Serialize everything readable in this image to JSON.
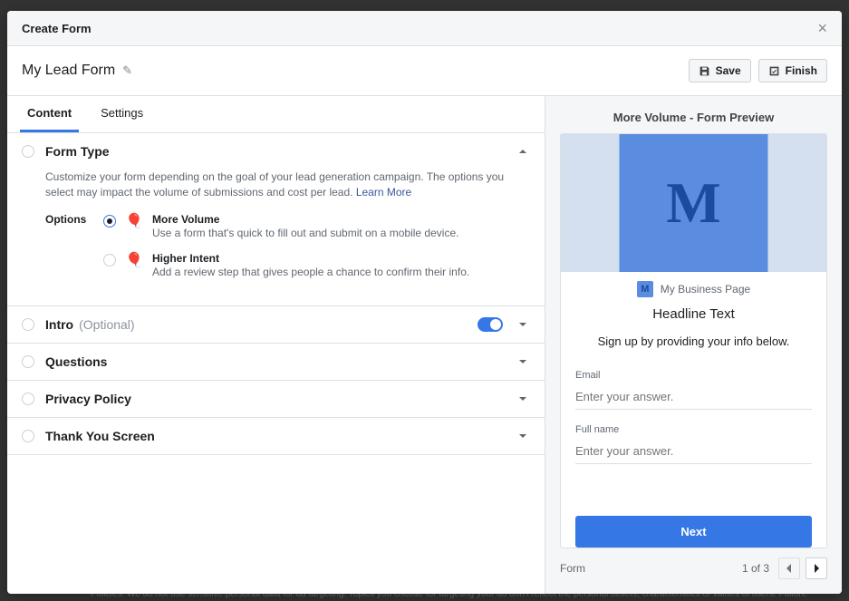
{
  "modal": {
    "title": "Create Form"
  },
  "form": {
    "name": "My Lead Form"
  },
  "buttons": {
    "save": "Save",
    "finish": "Finish"
  },
  "tabs": {
    "content": "Content",
    "settings": "Settings"
  },
  "formType": {
    "title": "Form Type",
    "desc": "Customize your form depending on the goal of your lead generation campaign. The options you select may impact the volume of submissions and cost per lead. ",
    "learnMore": "Learn More",
    "optionsLabel": "Options",
    "options": [
      {
        "title": "More Volume",
        "desc": "Use a form that's quick to fill out and submit on a mobile device.",
        "checked": true
      },
      {
        "title": "Higher Intent",
        "desc": "Add a review step that gives people a chance to confirm their info.",
        "checked": false
      }
    ]
  },
  "sections": {
    "intro": {
      "title": "Intro",
      "optional": "(Optional)"
    },
    "questions": {
      "title": "Questions"
    },
    "privacy": {
      "title": "Privacy Policy"
    },
    "thankyou": {
      "title": "Thank You Screen"
    }
  },
  "preview": {
    "title": "More Volume - Form Preview",
    "heroLetter": "M",
    "badgeLetter": "M",
    "bizName": "My Business Page",
    "headline": "Headline Text",
    "subhead": "Sign up by providing your info below.",
    "fields": [
      {
        "label": "Email",
        "placeholder": "Enter your answer."
      },
      {
        "label": "Full name",
        "placeholder": "Enter your answer."
      }
    ],
    "next": "Next",
    "pager": {
      "label": "Form",
      "count": "1 of 3"
    }
  },
  "bgText": "Policies. We do not use sensitive personal data for ad targeting. Topics you choose for targeting your ad don't reflect the personal beliefs, characteristics or values of users. Failure"
}
